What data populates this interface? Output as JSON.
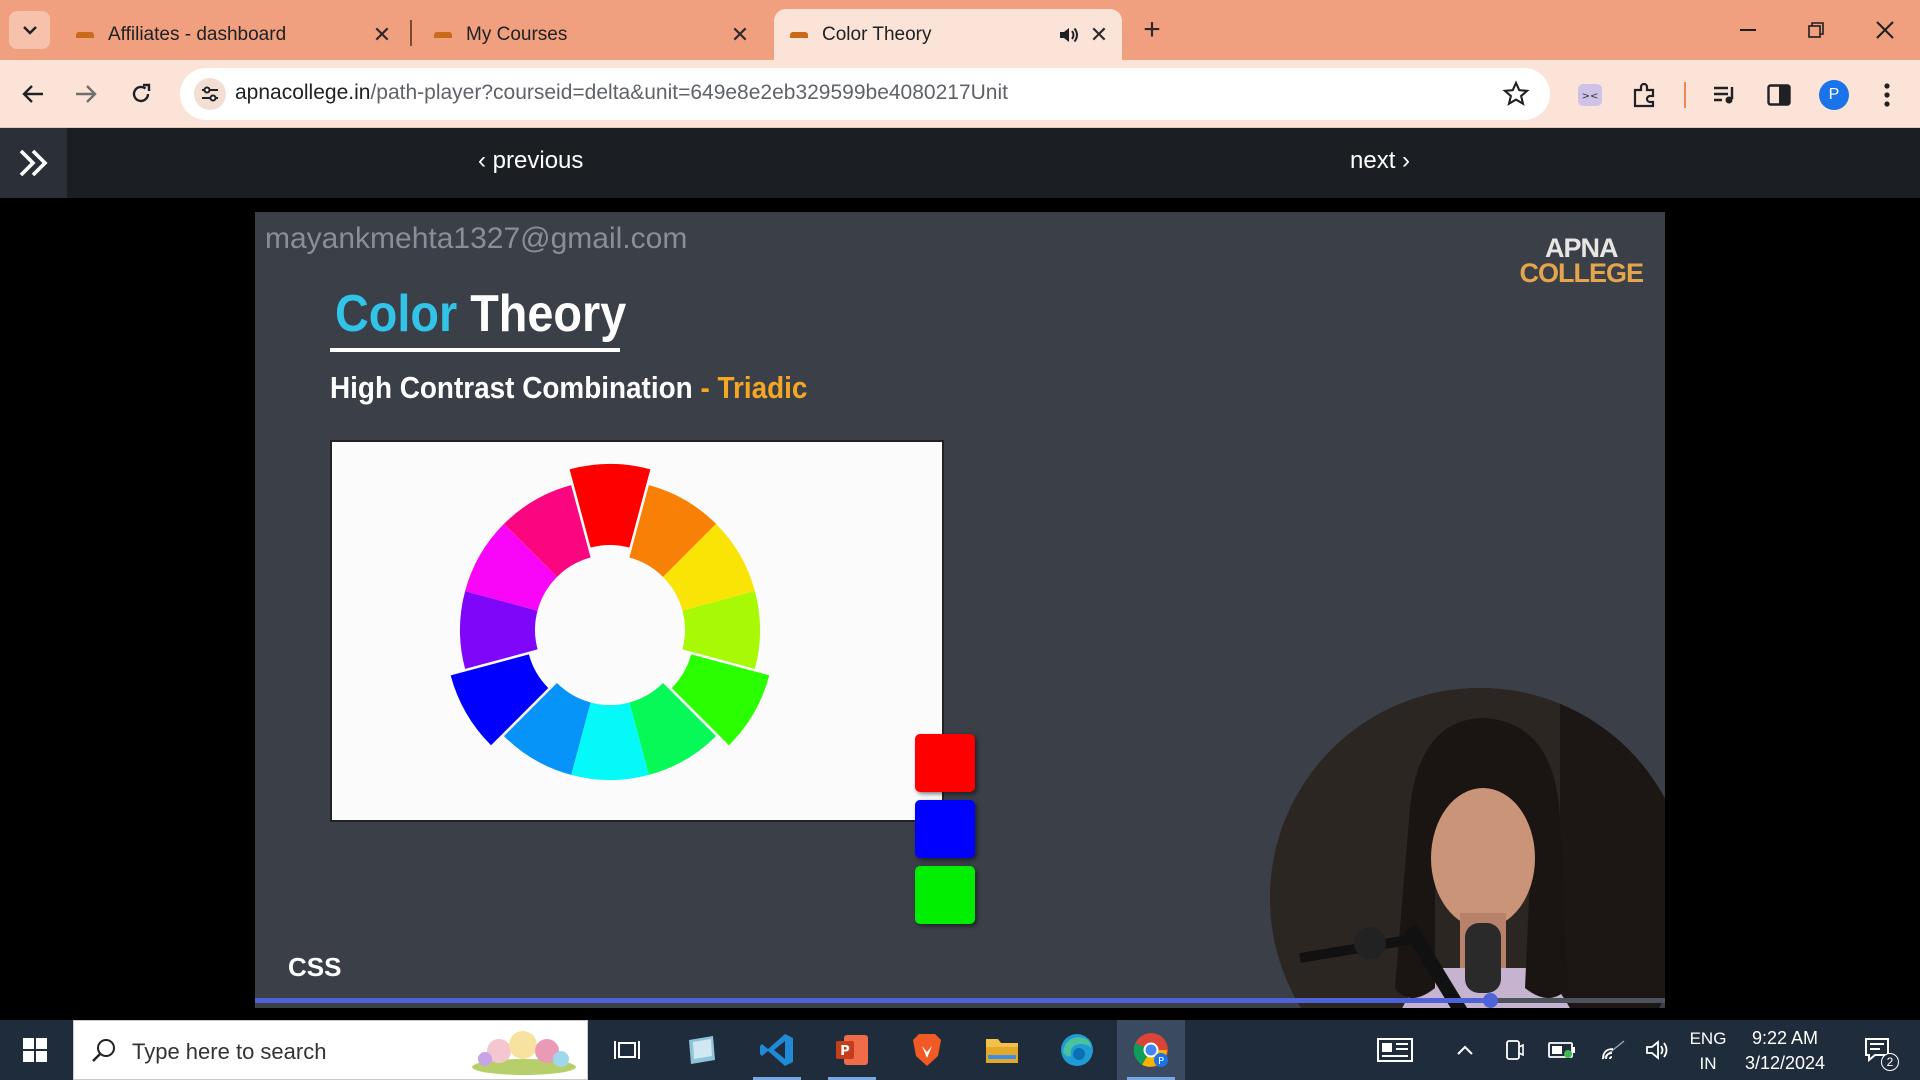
{
  "browser": {
    "tabs": [
      {
        "label": "Affiliates - dashboard",
        "active": false
      },
      {
        "label": "My Courses",
        "active": false
      },
      {
        "label": "Color Theory",
        "active": true,
        "audio": "speaker-icon"
      }
    ],
    "url_domain": "apnacollege.in",
    "url_path": "/path-player?courseid=delta&unit=649e8e2eb329599be4080217Unit",
    "profile_initial": "P"
  },
  "player": {
    "prev_label": "previous",
    "next_label": "next"
  },
  "video": {
    "watermark": "mayankmehta1327@gmail.com",
    "brand_line1": "APNA",
    "brand_line2": "COLLEGE",
    "title_part1": "Color",
    "title_part2": "Theory",
    "subtitle_main": "High Contrast Combination",
    "subtitle_accent": "- Triadic",
    "footer_label": "CSS",
    "swatches": [
      "#ff0000",
      "#0000ff",
      "#00ee00"
    ],
    "progress_fraction": 0.876,
    "accent_color": "#31c3e8"
  },
  "taskbar": {
    "search_placeholder": "Type here to search",
    "apps": [
      "task-view-icon",
      "notes-icon",
      "vscode-icon",
      "powerpoint-icon",
      "brave-icon",
      "file-explorer-icon",
      "edge-icon",
      "chrome-icon"
    ],
    "lang_line1": "ENG",
    "lang_line2": "IN",
    "time": "9:22 AM",
    "date": "3/12/2024",
    "notification_count": "2"
  }
}
